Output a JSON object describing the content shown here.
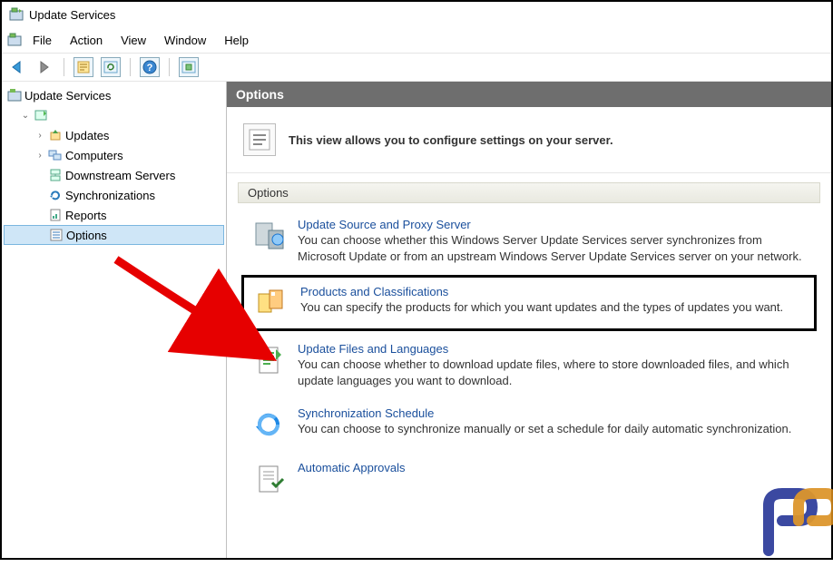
{
  "window": {
    "title": "Update Services"
  },
  "menu": {
    "file": "File",
    "action": "Action",
    "view": "View",
    "window": "Window",
    "help": "Help"
  },
  "tree": {
    "root": "Update Services",
    "server_placeholder": "",
    "updates": "Updates",
    "computers": "Computers",
    "downstream": "Downstream Servers",
    "sync": "Synchronizations",
    "reports": "Reports",
    "options": "Options"
  },
  "panel": {
    "title": "Options",
    "intro": "This view allows you to configure settings on your server.",
    "section": "Options"
  },
  "options": [
    {
      "title": "Update Source and Proxy Server",
      "desc": "You can choose whether this Windows Server Update Services server synchronizes from Microsoft Update or from an upstream Windows Server Update Services server on your network."
    },
    {
      "title": "Products and Classifications",
      "desc": "You can specify the products for which you want updates and the types of updates you want."
    },
    {
      "title": "Update Files and Languages",
      "desc": "You can choose whether to download update files, where to store downloaded files, and which update languages you want to download."
    },
    {
      "title": "Synchronization Schedule",
      "desc": "You can choose to synchronize manually or set a schedule for daily automatic synchronization."
    },
    {
      "title": "Automatic Approvals",
      "desc": ""
    }
  ]
}
